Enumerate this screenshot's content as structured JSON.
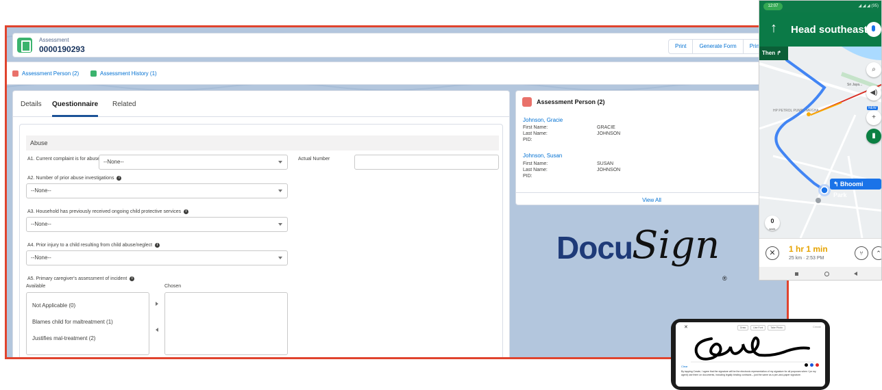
{
  "record": {
    "type_label": "Assessment",
    "name": "0000190293",
    "buttons": [
      "Print",
      "Generate Form",
      "Printable"
    ]
  },
  "related_links": [
    {
      "label": "Assessment Person (2)",
      "color": "#e9716a"
    },
    {
      "label": "Assessment History (1)",
      "color": "#3bb36d"
    }
  ],
  "tabs": [
    {
      "label": "Details",
      "active": false
    },
    {
      "label": "Questionnaire",
      "active": true
    },
    {
      "label": "Related",
      "active": false
    }
  ],
  "form": {
    "section": "Abuse",
    "a1_label": "A1. Current complaint is for abuse",
    "a1_value": "--None--",
    "actual_number_label": "Actual Number",
    "a2_label": "A2. Number of prior abuse investigations",
    "a2_value": "--None--",
    "a3_label": "A3. Household has previously received ongoing child protective services",
    "a3_value": "--None--",
    "a4_label": "A4. Prior injury to a child resulting from child abuse/neglect",
    "a4_value": "--None--",
    "a5_label": "A5. Primary caregiver's assessment of incident",
    "available_label": "Available",
    "chosen_label": "Chosen",
    "available_options": [
      "Not Applicable (0)",
      "Blames child for maltreatment (1)",
      "Justifies mal-treatment (2)"
    ]
  },
  "side_panel": {
    "title": "Assessment Person (2)",
    "persons": [
      {
        "name": "Johnson, Gracie",
        "first_label": "First Name:",
        "first": "GRACIE",
        "last_label": "Last Name:",
        "last": "JOHNSON",
        "pid_label": "PID:"
      },
      {
        "name": "Johnson, Susan",
        "first_label": "First Name:",
        "first": "SUSAN",
        "last_label": "Last Name:",
        "last": "JOHNSON",
        "pid_label": "PID:"
      }
    ],
    "view_all": "View All"
  },
  "docusign": {
    "brand_a": "Docu",
    "brand_b": "Sign",
    "reg": "®"
  },
  "map": {
    "status_pill": "12:07",
    "status_right": "◢ ◢ ◢ (95)",
    "direction": "Head southeast",
    "then_label": "Then ↱",
    "destination": "↰ Bhoomi Park",
    "poi_1": "Sri Jaya...",
    "poi_2": "HP PETROL PUMP - MEGHA",
    "new_tag": "NEW",
    "speed_value": "0",
    "speed_unit": "km/h",
    "eta_time": "1 hr 1 min",
    "eta_detail": "25 km · 2:53 PM"
  },
  "signature": {
    "tabs": [
      "Draw",
      "Use Font",
      "Take Photo"
    ],
    "create": "Create",
    "clear": "Clear",
    "legal": "By tapping Create, I agree that the signature will be the electronic representation of my signature for all purposes when I (or my agent) use them on documents, including legally binding contracts – just the same as a pen-and-paper signature.",
    "ink_colors": [
      "#000000",
      "#1a56db",
      "#e02424"
    ]
  }
}
